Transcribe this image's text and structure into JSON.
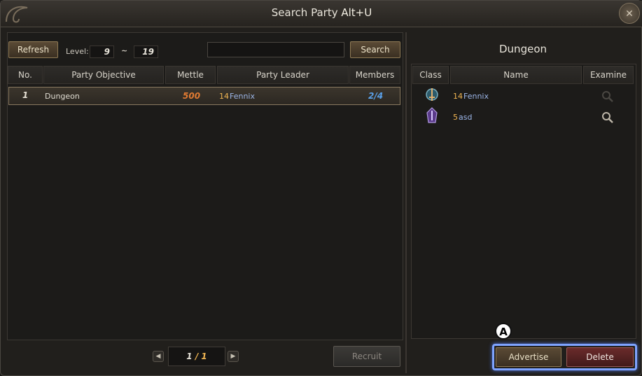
{
  "window": {
    "title": "Search Party",
    "hotkey": "Alt+U"
  },
  "toolbar": {
    "refresh_label": "Refresh",
    "level_label": "Level:",
    "level_min": "9",
    "level_sep": "~",
    "level_max": "19",
    "search_value": "",
    "search_label": "Search"
  },
  "party_table": {
    "headers": [
      "No.",
      "Party Objective",
      "Mettle",
      "Party Leader",
      "Members"
    ],
    "rows": [
      {
        "no": "1",
        "objective": "Dungeon",
        "mettle": "500",
        "leader_level": "14",
        "leader_name": "Fennix",
        "members": "2/4"
      }
    ]
  },
  "pagination": {
    "current": "1",
    "total": "/ 1",
    "recruit_label": "Recruit"
  },
  "detail": {
    "title": "Dungeon",
    "headers": [
      "Class",
      "Name",
      "Examine"
    ],
    "members": [
      {
        "level": "14",
        "name": "Fennix",
        "class_icon": "warrior-class-icon",
        "examine_enabled": false
      },
      {
        "level": "5",
        "name": "asd",
        "class_icon": "mage-class-icon",
        "examine_enabled": true
      }
    ],
    "advertise_label": "Advertise",
    "delete_label": "Delete"
  },
  "annotation": {
    "marker": "A"
  },
  "colors": {
    "level": "#f0b552",
    "name": "#9cb6e8",
    "mettle": "#e07a32",
    "members": "#5aa0e8",
    "highlight": "#7ea3ff"
  }
}
